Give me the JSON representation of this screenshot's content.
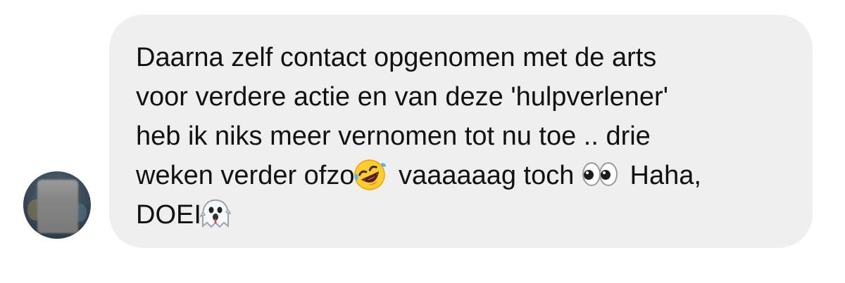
{
  "message": {
    "line1": "Daarna zelf contact opgenomen met de arts",
    "line2": "voor verdere actie en van deze 'hulpverlener'",
    "line3": "heb ik niks meer vernomen tot nu toe .. drie",
    "line4a": "weken verder ofzo",
    "line4b": " vaaaaaag toch ",
    "line4c": " Haha,",
    "line5": "DOEI"
  },
  "icons": {
    "avatar": "avatar-blurred",
    "emoji_1": "rolling-on-floor-laughing-icon",
    "emoji_2": "eyes-icon",
    "emoji_3": "ghost-icon"
  },
  "colors": {
    "bubble": "#efefef",
    "text": "#111111",
    "background": "#ffffff"
  }
}
